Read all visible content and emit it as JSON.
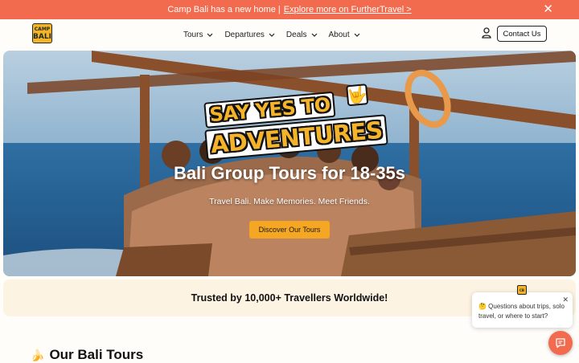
{
  "announcement": {
    "text": "Camp Bali has a new home |",
    "link": "Explore more on FurtherTravel >",
    "close": "✕"
  },
  "nav": {
    "logo_line1": "CAMP",
    "logo_line2": "BALI",
    "items": [
      {
        "label": "Tours"
      },
      {
        "label": "Departures"
      },
      {
        "label": "Deals"
      },
      {
        "label": "About"
      }
    ],
    "contact_label": "Contact Us"
  },
  "hero": {
    "badge_line1": "SAY YES TO",
    "badge_line2": "ADVENTURES",
    "badge_icon": "🤟",
    "headline": "Bali Group Tours for 18-35s",
    "subline": "Travel Bali. Make Memories. Meet Friends.",
    "cta": "Discover Our Tours"
  },
  "trust": {
    "text": "Trusted by 10,000+ Travellers Worldwide!"
  },
  "tours": {
    "emoji": "🍌",
    "title": "Our Bali Tours"
  },
  "chat": {
    "avatar_text": "CB",
    "message": "🤔 Questions about trips, solo travel, or where to start?",
    "close": "✕"
  },
  "colors": {
    "accent": "#f26b4e",
    "cta": "#f5a623",
    "brand_yellow": "#f5b32a"
  }
}
